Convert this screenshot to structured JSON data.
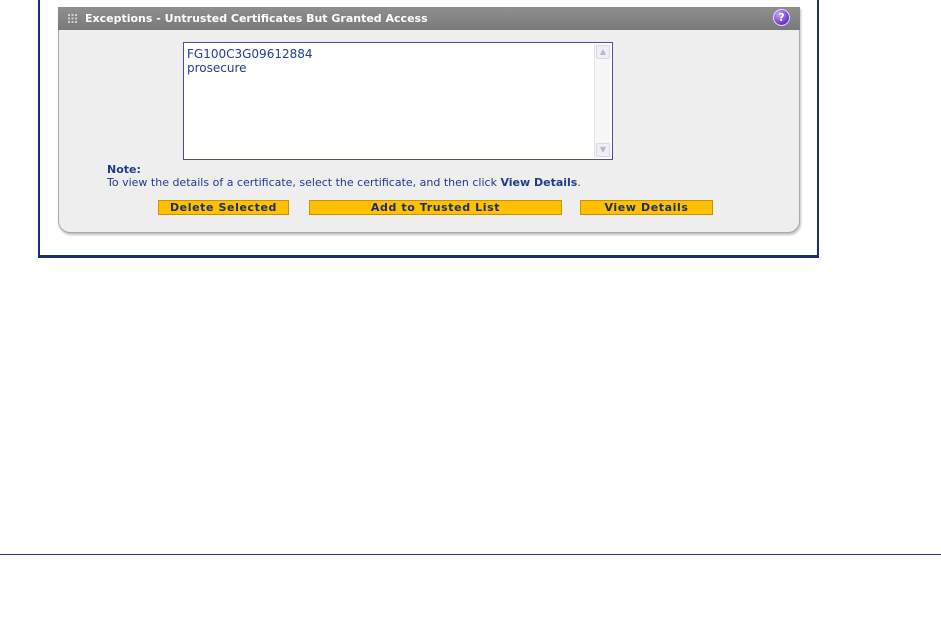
{
  "panel": {
    "title": "Exceptions - Untrusted Certificates But Granted Access",
    "help_label": "?"
  },
  "certificates": [
    "FG100C3G09612884",
    "prosecure"
  ],
  "note": {
    "title": "Note:",
    "text_before": "To view the details of a certificate, select the certificate, and then click ",
    "text_bold": "View Details",
    "text_after": "."
  },
  "buttons": {
    "delete": "Delete Selected",
    "add": "Add to Trusted List",
    "view": "View Details"
  },
  "icons": {
    "grip": "grip-icon",
    "help": "help-icon",
    "scroll_up": "chevron-up-icon",
    "scroll_down": "chevron-down-icon"
  },
  "colors": {
    "button_bg": "#ffc000",
    "header_bg": "#868686",
    "text": "#22398a",
    "frame": "#1f2c6e"
  }
}
